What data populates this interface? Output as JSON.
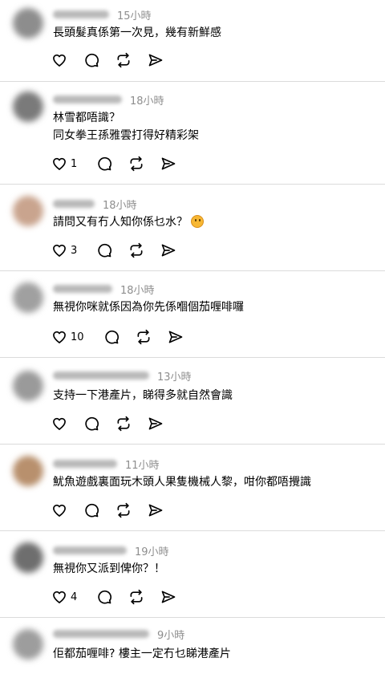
{
  "comments": [
    {
      "time": "15小時",
      "lines": [
        "長頭髮真係第一次見，幾有新鮮感"
      ],
      "likes": "",
      "avatar_color": "#8d8d8d"
    },
    {
      "time": "18小時",
      "lines": [
        "林雪都唔識？",
        "同女拳王孫雅雲打得好精彩架"
      ],
      "likes": "1",
      "avatar_color": "#7a7a7a"
    },
    {
      "time": "18小時",
      "lines": [
        "請問又有冇人知你係乜水？"
      ],
      "likes": "3",
      "avatar_color": "#c9a48e",
      "emoji": "thinking-face-emoji"
    },
    {
      "time": "18小時",
      "lines": [
        "無視你咪就係因為你先係嗰個茄喱啡囉"
      ],
      "likes": "10",
      "avatar_color": "#a0a0a0"
    },
    {
      "time": "13小時",
      "lines": [
        "支持一下港產片，睇得多就自然會識"
      ],
      "likes": "",
      "avatar_color": "#9a9a9a"
    },
    {
      "time": "11小時",
      "lines": [
        "魷魚遊戲裏面玩木頭人果隻機械人黎，咁你都唔攪識"
      ],
      "likes": "",
      "avatar_color": "#b8906d"
    },
    {
      "time": "19小時",
      "lines": [
        "無視你又派到俾你？！"
      ],
      "likes": "4",
      "avatar_color": "#6e6e6e"
    },
    {
      "time": "9小時",
      "lines": [
        "佢都茄喱啡? 樓主一定冇乜睇港產片"
      ],
      "likes": "",
      "avatar_color": "#9d9d9d"
    }
  ],
  "icons": {
    "like": "heart-icon",
    "reply": "comment-icon",
    "repost": "repost-icon",
    "share": "share-icon"
  }
}
